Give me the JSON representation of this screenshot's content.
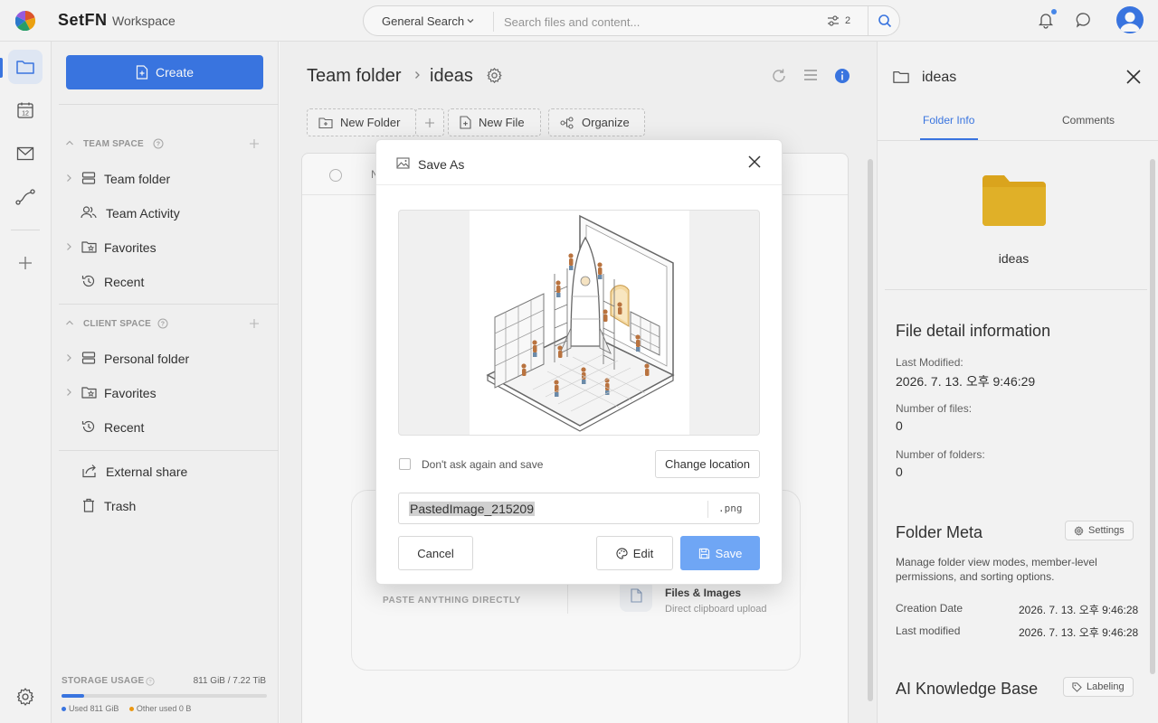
{
  "app": {
    "brand": "SetFN",
    "workspace": "Workspace"
  },
  "search": {
    "scope": "General Search",
    "placeholder": "Search files and content...",
    "filter_count": "2"
  },
  "colors": {
    "accent": "#3b78e7",
    "folder": "#E2AA1E",
    "save_button": "#6fa6f5"
  },
  "rail": {
    "icons": [
      "folder-icon",
      "calendar-icon",
      "mail-icon",
      "route-icon",
      "plus-icon",
      "settings-icon"
    ],
    "calendar_day": "12"
  },
  "sidebar": {
    "create_label": "Create",
    "team_space": {
      "title": "TEAM SPACE",
      "items": [
        {
          "label": "Team folder",
          "icon": "storage-icon",
          "expandable": true
        },
        {
          "label": "Team Activity",
          "icon": "users-icon",
          "expandable": false
        },
        {
          "label": "Favorites",
          "icon": "star-folder-icon",
          "expandable": true
        },
        {
          "label": "Recent",
          "icon": "history-icon",
          "expandable": false
        }
      ]
    },
    "client_space": {
      "title": "CLIENT SPACE",
      "items": [
        {
          "label": "Personal folder",
          "icon": "storage-icon",
          "expandable": true
        },
        {
          "label": "Favorites",
          "icon": "star-folder-icon",
          "expandable": true
        },
        {
          "label": "Recent",
          "icon": "history-icon",
          "expandable": false
        }
      ]
    },
    "extra": [
      {
        "label": "External share",
        "icon": "share-icon"
      },
      {
        "label": "Trash",
        "icon": "trash-icon"
      }
    ],
    "storage": {
      "label": "STORAGE USAGE",
      "value": "811 GiB / 7.22 TiB",
      "used_fraction": 0.11,
      "used_label": "Used 811 GiB",
      "other_label": "Other used 0 B"
    }
  },
  "main": {
    "breadcrumb": {
      "root": "Team folder",
      "current": "ideas"
    },
    "toolbar": {
      "new_folder": "New Folder",
      "new_file": "New File",
      "organize": "Organize"
    },
    "list_header_name": "N",
    "paste": {
      "left_text": "PASTE ANYTHING DIRECTLY",
      "files_title": "Files & Images",
      "files_sub": "Direct clipboard upload"
    }
  },
  "panel": {
    "title": "ideas",
    "tabs": [
      "Folder Info",
      "Comments"
    ],
    "active_tab": 0,
    "folder_label": "ideas",
    "file_detail": {
      "heading": "File detail information",
      "last_modified_label": "Last Modified:",
      "last_modified": "2026. 7. 13. 오후 9:46:29",
      "num_files_label": "Number of files:",
      "num_files": "0",
      "num_folders_label": "Number of folders:",
      "num_folders": "0"
    },
    "folder_meta": {
      "heading": "Folder Meta",
      "settings_label": "Settings",
      "description": "Manage folder view modes, member-level permissions, and sorting options.",
      "creation_label": "Creation Date",
      "creation_value": "2026. 7. 13. 오후 9:46:28",
      "modified_label": "Last modified",
      "modified_value": "2026. 7. 13. 오후 9:46:28"
    },
    "ai_kb": {
      "heading": "AI Knowledge Base",
      "labeling_label": "Labeling"
    }
  },
  "dialog": {
    "title": "Save As",
    "dont_ask_label": "Don't ask again and save",
    "change_location_label": "Change location",
    "filename": "PastedImage_215209",
    "extension": ".png",
    "cancel_label": "Cancel",
    "edit_label": "Edit",
    "save_label": "Save"
  }
}
